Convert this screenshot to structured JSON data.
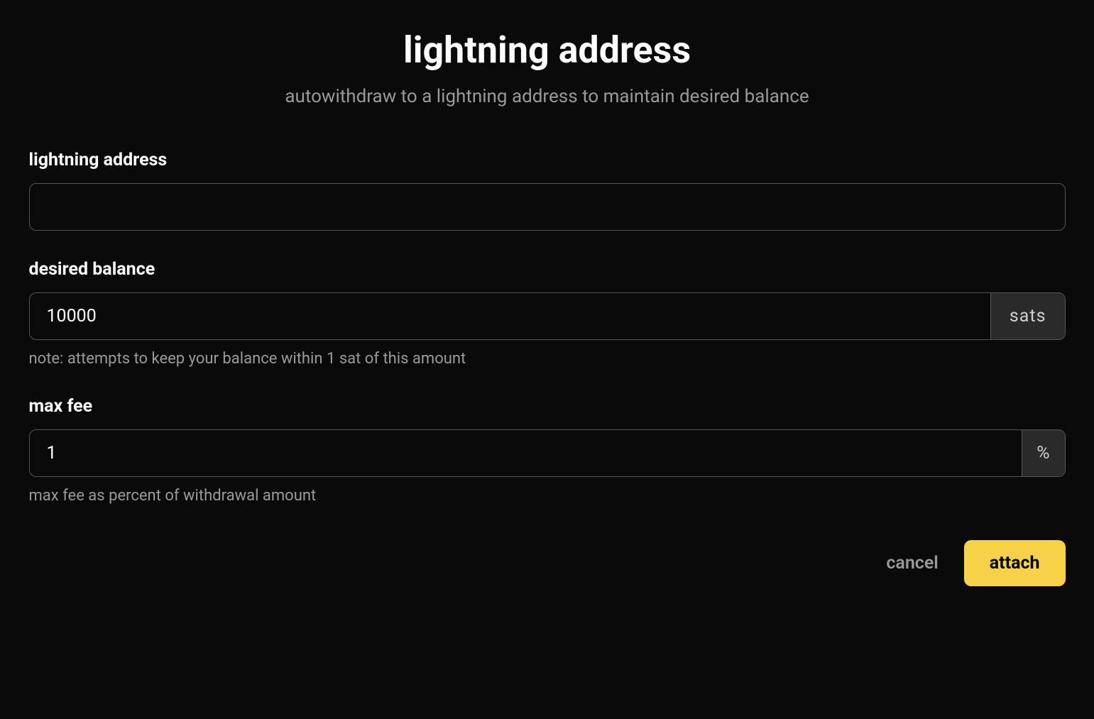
{
  "header": {
    "title": "lightning address",
    "subtitle": "autowithdraw to a lightning address to maintain desired balance"
  },
  "fields": {
    "lightning_address": {
      "label": "lightning address",
      "value": ""
    },
    "desired_balance": {
      "label": "desired balance",
      "value": "10000",
      "suffix": "sats",
      "helper": "note: attempts to keep your balance within 1 sat of this amount"
    },
    "max_fee": {
      "label": "max fee",
      "value": "1",
      "suffix": "%",
      "helper": "max fee as percent of withdrawal amount"
    }
  },
  "buttons": {
    "cancel": "cancel",
    "attach": "attach"
  },
  "colors": {
    "background": "#0a0a0a",
    "text_primary": "#ffffff",
    "text_secondary": "#9a9a9a",
    "border": "#555555",
    "suffix_bg": "#2a2a2a",
    "accent": "#f7d147"
  }
}
